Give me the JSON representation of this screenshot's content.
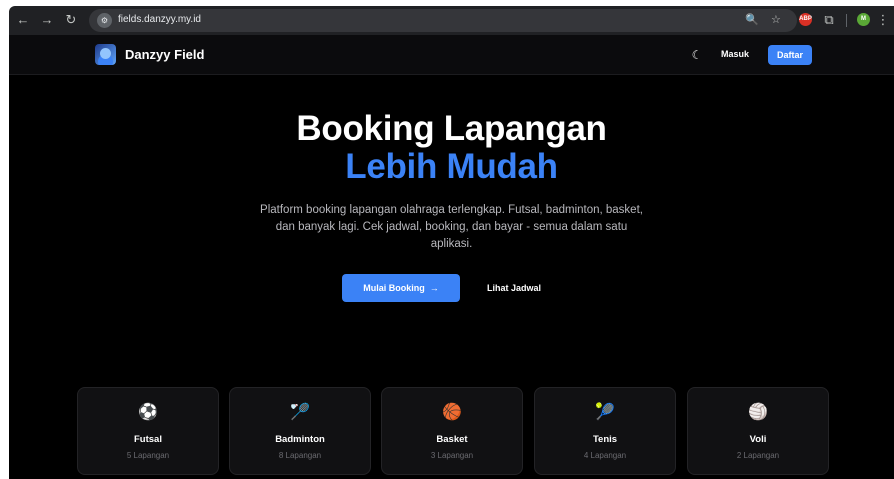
{
  "browser": {
    "url": "fields.danzyy.my.id",
    "back_icon": "←",
    "forward_icon": "→",
    "reload_icon": "↻",
    "site_info_icon": "⚙",
    "zoom_icon": "🔍",
    "bookmark_icon": "☆",
    "adblock_label": "ABP",
    "extensions_icon": "⧉",
    "profile_initial": "M",
    "menu_icon": "⋮"
  },
  "navbar": {
    "brand": "Danzyy Field",
    "theme_icon": "☾",
    "login_label": "Masuk",
    "register_label": "Daftar"
  },
  "hero": {
    "title_line1": "Booking Lapangan",
    "title_line2": "Lebih Mudah",
    "description": "Platform booking lapangan olahraga terlengkap. Futsal, badminton, basket, dan banyak lagi. Cek jadwal, booking, dan bayar - semua dalam satu aplikasi.",
    "primary_cta": "Mulai Booking",
    "primary_cta_arrow": "→",
    "secondary_cta": "Lihat Jadwal"
  },
  "sports": [
    {
      "name": "Futsal",
      "count": "5 Lapangan",
      "icon": "⚽",
      "icon_name": "soccer-ball-icon"
    },
    {
      "name": "Badminton",
      "count": "8 Lapangan",
      "icon": "🏸",
      "icon_name": "badminton-icon"
    },
    {
      "name": "Basket",
      "count": "3 Lapangan",
      "icon": "🏀",
      "icon_name": "basketball-icon"
    },
    {
      "name": "Tenis",
      "count": "4 Lapangan",
      "icon": "🎾",
      "icon_name": "tennis-racket-icon"
    },
    {
      "name": "Voli",
      "count": "2 Lapangan",
      "icon": "🏐",
      "icon_name": "volleyball-icon"
    }
  ],
  "colors": {
    "accent": "#3b82f6",
    "background": "#000000",
    "card": "#111113"
  }
}
